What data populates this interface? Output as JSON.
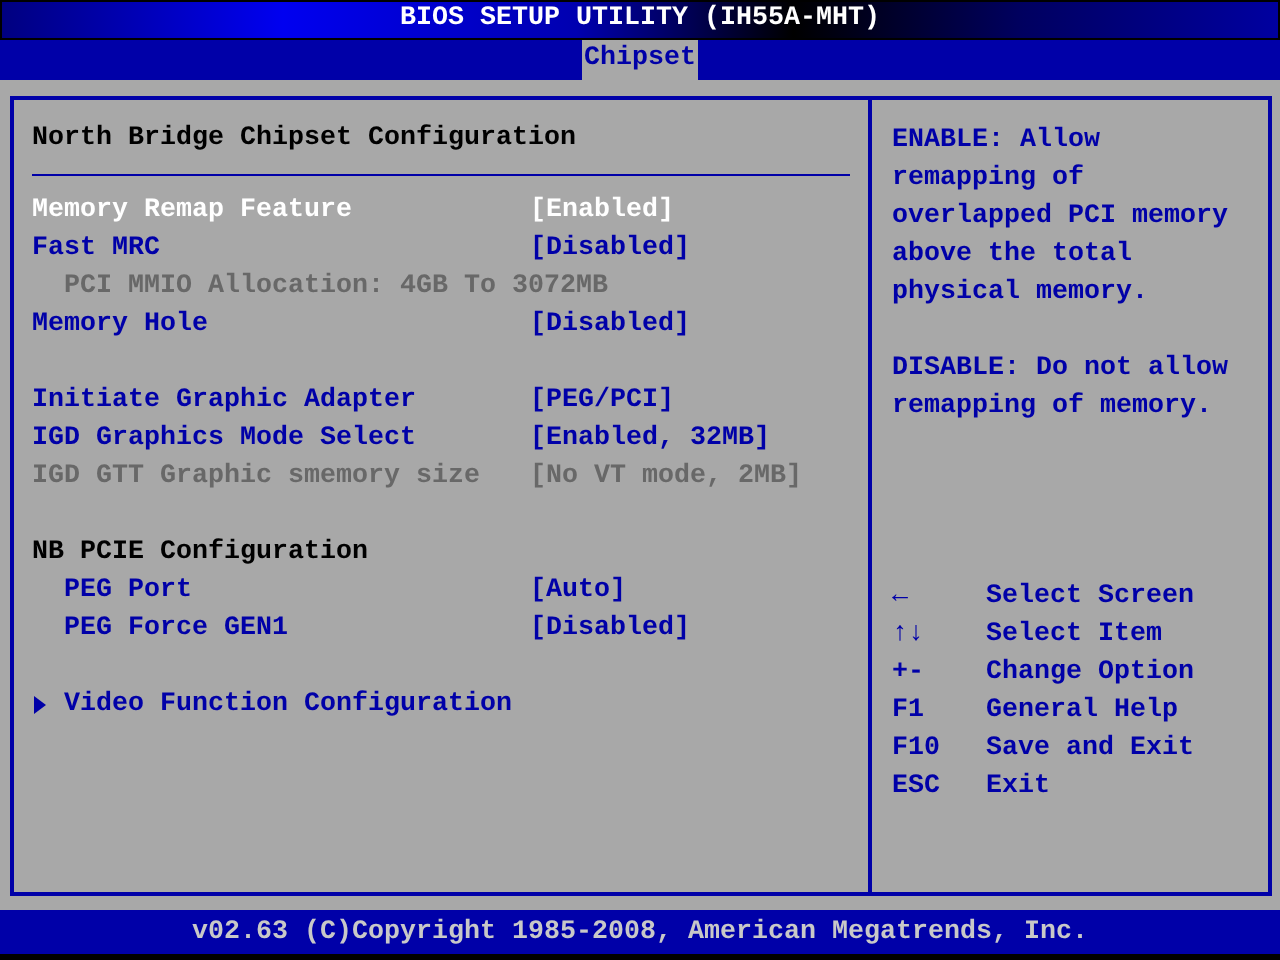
{
  "window": {
    "title": "BIOS SETUP UTILITY (IH55A-MHT)"
  },
  "tabs": [
    {
      "label": "Chipset",
      "selected": true
    }
  ],
  "menu": {
    "title": "North Bridge Chipset Configuration",
    "items": [
      {
        "kind": "setting",
        "label": "Memory Remap Feature",
        "value": "[Enabled]",
        "selected": true,
        "disabled": false,
        "gap_before": false
      },
      {
        "kind": "setting",
        "label": "Fast MRC",
        "value": "[Disabled]",
        "selected": false,
        "disabled": false,
        "gap_before": false,
        "children": [
          {
            "kind": "info",
            "label": "PCI MMIO Allocation: 4GB To 3072MB",
            "selected": false,
            "disabled": true,
            "gap_before": false
          }
        ]
      },
      {
        "kind": "setting",
        "label": "Memory Hole",
        "value": "[Disabled]",
        "selected": false,
        "disabled": false,
        "gap_before": false
      },
      {
        "kind": "setting",
        "label": "Initiate Graphic Adapter",
        "value": "[PEG/PCI]",
        "selected": false,
        "disabled": false,
        "gap_before": true
      },
      {
        "kind": "setting",
        "label": "IGD Graphics Mode Select",
        "value": "[Enabled, 32MB]",
        "selected": false,
        "disabled": false,
        "gap_before": false
      },
      {
        "kind": "setting",
        "label": "IGD GTT Graphic smemory size",
        "value": "[No VT mode, 2MB]",
        "selected": false,
        "disabled": true,
        "gap_before": false
      },
      {
        "kind": "heading",
        "label": "NB PCIE Configuration",
        "selected": false,
        "disabled": false,
        "gap_before": true,
        "children": [
          {
            "kind": "setting",
            "label": "PEG Port",
            "value": "[Auto]",
            "selected": false,
            "disabled": false,
            "gap_before": false
          },
          {
            "kind": "setting",
            "label": "PEG Force GEN1",
            "value": "[Disabled]",
            "selected": false,
            "disabled": false,
            "gap_before": false
          }
        ]
      },
      {
        "kind": "submenu",
        "label": "Video Function Configuration",
        "selected": false,
        "disabled": false,
        "gap_before": true
      }
    ]
  },
  "help": {
    "paragraphs": [
      "ENABLE: Allow remapping of overlapped PCI memory above the total physical memory.",
      "DISABLE: Do not allow remapping of memory."
    ],
    "keys": [
      {
        "key": "←",
        "action": "Select Screen"
      },
      {
        "key": "↑↓",
        "action": "Select Item"
      },
      {
        "key": "+-",
        "action": "Change Option"
      },
      {
        "key": "F1",
        "action": "General Help"
      },
      {
        "key": "F10",
        "action": "Save and Exit"
      },
      {
        "key": "ESC",
        "action": "Exit"
      }
    ]
  },
  "status_bar": "v02.63 (C)Copyright 1985-2008, American Megatrends, Inc."
}
